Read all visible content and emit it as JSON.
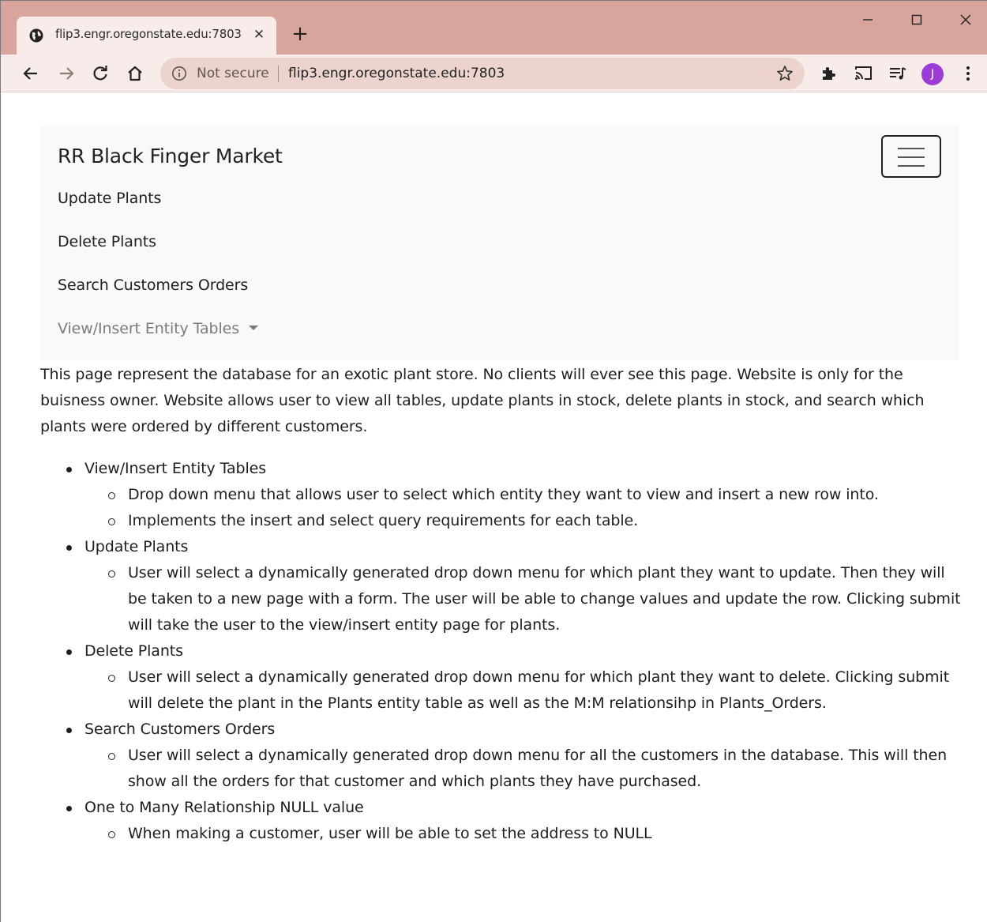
{
  "browser": {
    "tab_title": "flip3.engr.oregonstate.edu:7803",
    "security_label": "Not secure",
    "url": "flip3.engr.oregonstate.edu:7803",
    "profile_initial": "J",
    "profile_color": "#9d3bd6",
    "frame_color": "#d7a59c"
  },
  "navbar": {
    "brand": "RR Black Finger Market",
    "links": [
      "Update Plants",
      "Delete Plants",
      "Search Customers Orders",
      "View/Insert Entity Tables"
    ]
  },
  "intro": "This page represent the database for an exotic plant store. No clients will ever see this page. Website is only for the buisness owner. Website allows user to view all tables, update plants in stock, delete plants in stock, and search which plants were ordered by different customers.",
  "features": [
    {
      "title": "View/Insert Entity Tables",
      "details": [
        "Drop down menu that allows user to select which entity they want to view and insert a new row into.",
        "Implements the insert and select query requirements for each table."
      ]
    },
    {
      "title": "Update Plants",
      "details": [
        "User will select a dynamically generated drop down menu for which plant they want to update. Then they will be taken to a new page with a form. The user will be able to change values and update the row. Clicking submit will take the user to the view/insert entity page for plants."
      ]
    },
    {
      "title": "Delete Plants",
      "details": [
        "User will select a dynamically generated drop down menu for which plant they want to delete. Clicking submit will delete the plant in the Plants entity table as well as the M:M relationsihp in Plants_Orders."
      ]
    },
    {
      "title": "Search Customers Orders",
      "details": [
        "User will select a dynamically generated drop down menu for all the customers in the database. This will then show all the orders for that customer and which plants they have purchased."
      ]
    },
    {
      "title": "One to Many Relationship NULL value",
      "details": [
        "When making a customer, user will be able to set the address to NULL"
      ]
    }
  ]
}
